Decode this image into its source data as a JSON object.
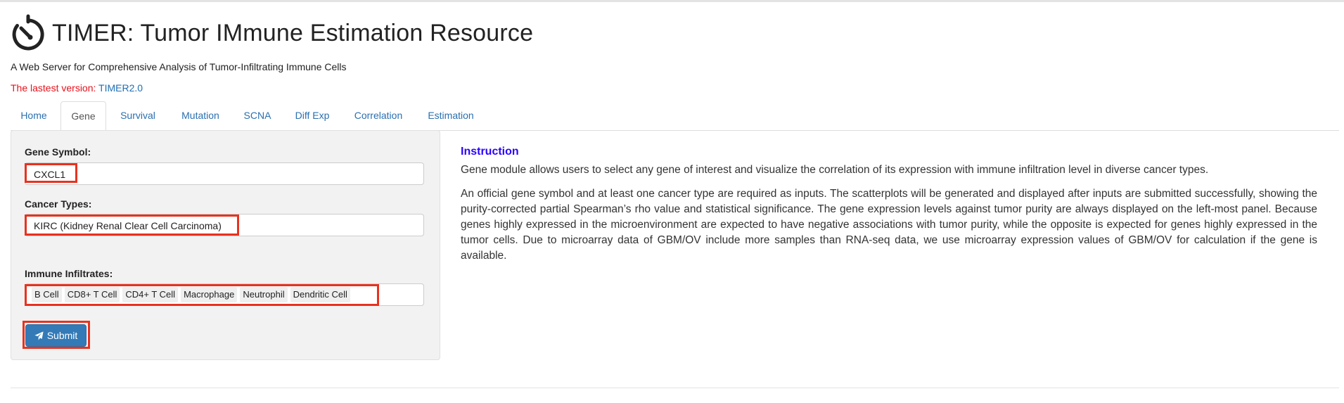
{
  "header": {
    "title": "TIMER: Tumor IMmune Estimation Resource",
    "subtitle": "A Web Server for Comprehensive Analysis of Tumor-Infiltrating Immune Cells",
    "version_prefix": "The lastest version: ",
    "version_link": "TIMER2.0",
    "logo_icon": "stopwatch-icon"
  },
  "tabs": [
    {
      "label": "Home"
    },
    {
      "label": "Gene"
    },
    {
      "label": "Survival"
    },
    {
      "label": "Mutation"
    },
    {
      "label": "SCNA"
    },
    {
      "label": "Diff Exp"
    },
    {
      "label": "Correlation"
    },
    {
      "label": "Estimation"
    }
  ],
  "active_tab": "Gene",
  "form": {
    "gene_label": "Gene Symbol:",
    "gene_value": "CXCL1",
    "cancer_label": "Cancer Types:",
    "cancer_value": "KIRC (Kidney Renal Clear Cell Carcinoma)",
    "immune_label": "Immune Infiltrates:",
    "immune_tags": [
      "B Cell",
      "CD8+ T Cell",
      "CD4+ T Cell",
      "Macrophage",
      "Neutrophil",
      "Dendritic Cell"
    ],
    "submit_label": "Submit",
    "submit_icon": "paper-plane-icon"
  },
  "instruction": {
    "heading": "Instruction",
    "p1": "Gene module allows users to select any gene of interest and visualize the correlation of its expression with immune infiltration level in diverse cancer types.",
    "p2": "An official gene symbol and at least one cancer type are required as inputs. The scatterplots will be generated and displayed after inputs are submitted successfully, showing the purity-corrected partial Spearman’s rho value and statistical significance. The gene expression levels against tumor purity are always displayed on the left-most panel. Because genes highly expressed in the microenvironment are expected to have negative associations with tumor purity, while the opposite is expected for genes highly expressed in the tumor cells. Due to microarray data of GBM/OV include more samples than RNA-seq data, we use microarray expression values of GBM/OV for calculation if the gene is available."
  },
  "colors": {
    "accent": "#337ab7",
    "link": "#2a6fb0",
    "highlight": "#e8321f",
    "instruction_heading": "#2b00ff",
    "version_text": "#e8101a"
  }
}
